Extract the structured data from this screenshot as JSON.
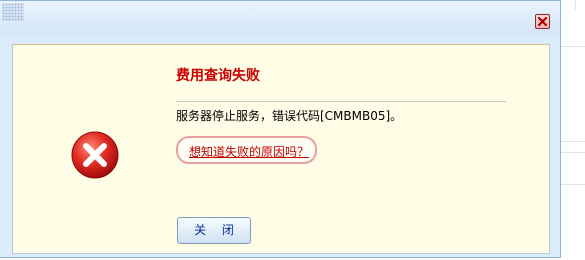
{
  "dialog": {
    "title": "费用查询失败",
    "message": "服务器停止服务，错误代码[CMBMB05]。",
    "help_link": "想知道失败的原因吗？",
    "close_button_label": "关 闭"
  },
  "icons": {
    "close": "close-icon",
    "error": "error-icon",
    "grip": "grip-icon"
  },
  "colors": {
    "title_red": "#c80000",
    "body_bg": "#fffde6",
    "frame_bg": "#dcebfa",
    "icon_red": "#d91c1c"
  }
}
